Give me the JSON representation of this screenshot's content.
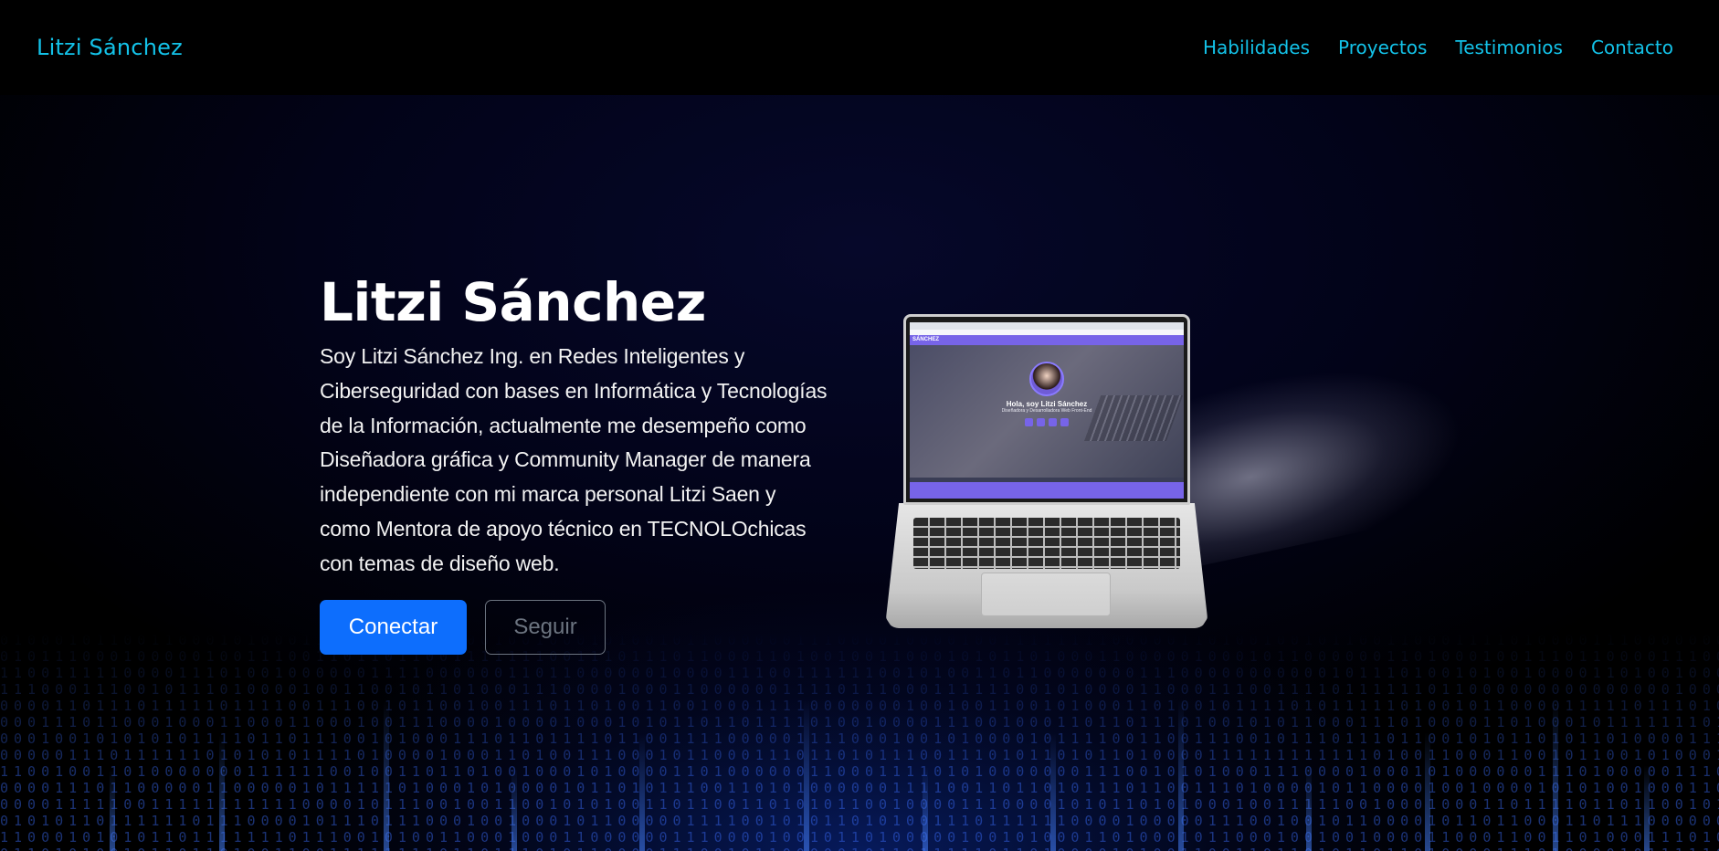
{
  "navbar": {
    "brand": "Litzi Sánchez",
    "links": [
      "Habilidades",
      "Proyectos",
      "Testimonios",
      "Contacto"
    ]
  },
  "hero": {
    "title": "Litzi Sánchez",
    "description": "Soy Litzi Sánchez Ing. en Redes Inteligentes y Ciberseguridad con bases en Informática y Tecnologías de la Información, actualmente me desempeño como Diseñadora gráfica y Community Manager de manera independiente con mi marca personal Litzi Saen y como Mentora de apoyo técnico en TECNOLOchicas con temas de diseño web.",
    "primary_button": "Conectar",
    "secondary_button": "Seguir"
  },
  "laptop_screen": {
    "nav_brand": "SÁNCHEZ",
    "greeting": "Hola, soy Litzi Sánchez",
    "subtitle": "Diseñadora y Desarrolladora Web Front-End"
  },
  "colors": {
    "accent": "#13c2e8",
    "primary_button": "#0d6efd",
    "outline_button": "#6c7480",
    "screen_accent": "#7764e8"
  }
}
